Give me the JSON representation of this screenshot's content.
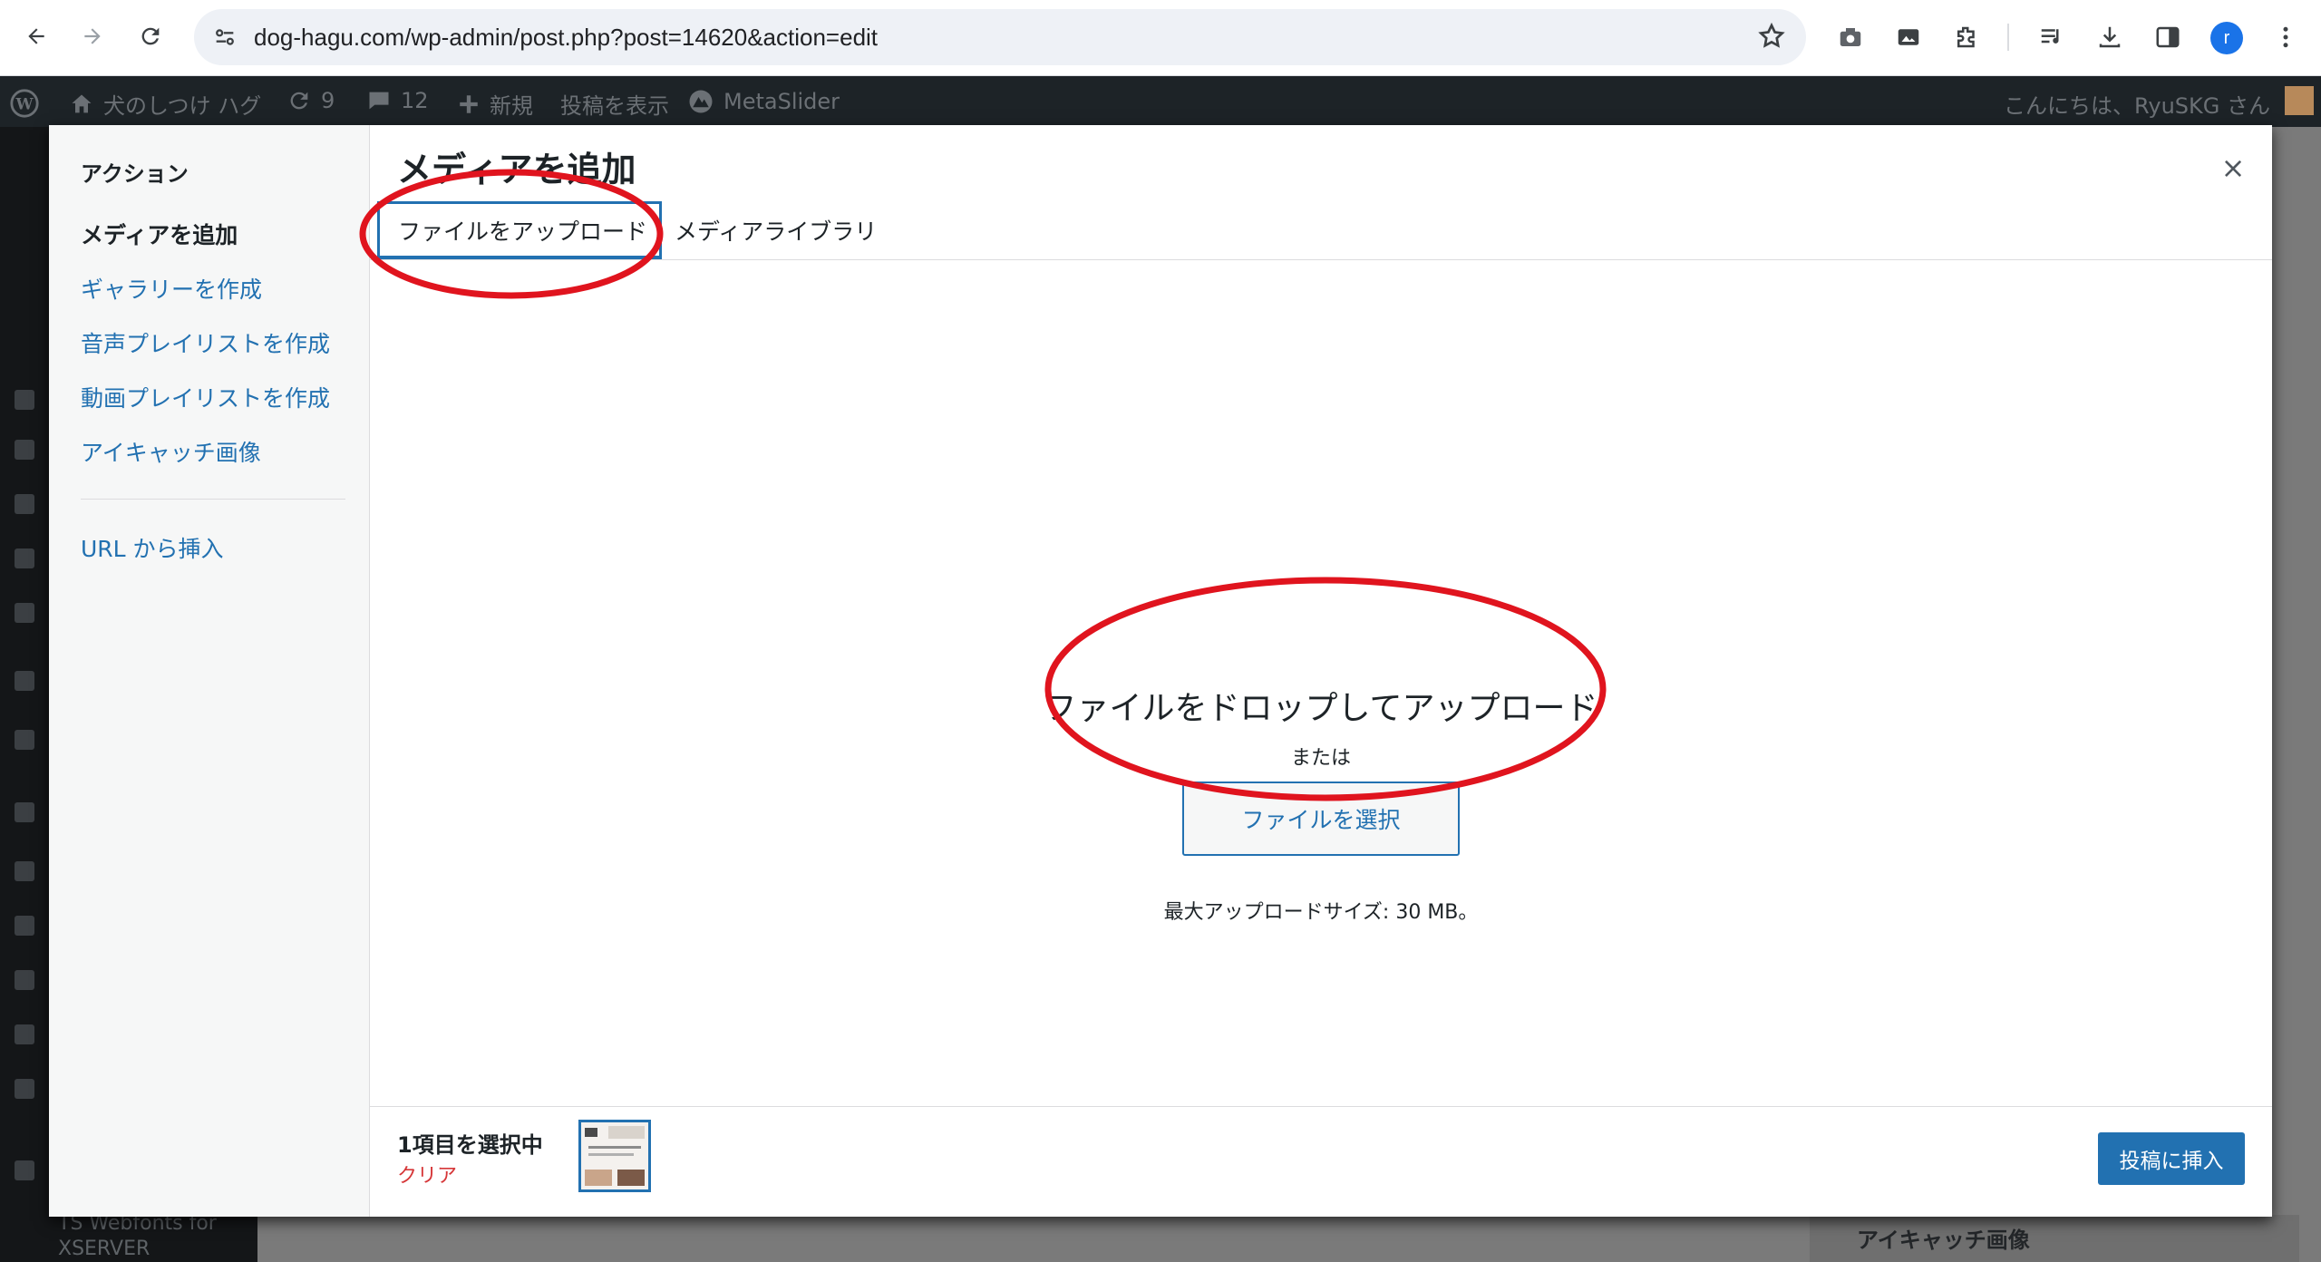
{
  "browser": {
    "url": "dog-hagu.com/wp-admin/post.php?post=14620&action=edit",
    "profile_initial": "r"
  },
  "adminbar": {
    "site_name": "犬のしつけ ハグ",
    "updates_count": "9",
    "comments_count": "12",
    "new_label": "新規",
    "view_post_label": "投稿を表示",
    "metaslider_label": "MetaSlider",
    "greeting": "こんにちは、RyuSKG さん"
  },
  "background": {
    "sidebar_bottom_label": "TS Webfonts for XSERVER",
    "featured_image_panel": "アイキャッチ画像"
  },
  "modal": {
    "menu_heading": "アクション",
    "menu_items": [
      "メディアを追加",
      "ギャラリーを作成",
      "音声プレイリストを作成",
      "動画プレイリストを作成",
      "アイキャッチ画像"
    ],
    "insert_from_url": "URL から挿入",
    "title": "メディアを追加",
    "close_symbol": "×",
    "tabs": [
      "ファイルをアップロード",
      "メディアライブラリ"
    ],
    "drop_title": "ファイルをドロップしてアップロード",
    "or_text": "または",
    "select_button": "ファイルを選択",
    "max_upload": "最大アップロードサイズ: 30 MB。",
    "selection_count": "1項目を選択中",
    "clear_label": "クリア",
    "insert_button": "投稿に挿入"
  },
  "colors": {
    "accent": "#2271b1",
    "annotation_red": "#e0141e",
    "adminbar_bg": "#1d2327"
  }
}
